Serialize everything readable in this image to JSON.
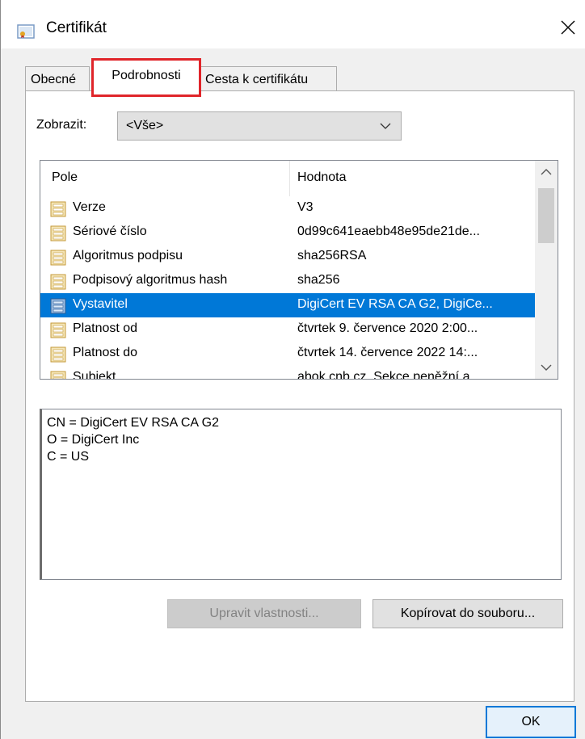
{
  "window": {
    "title": "Certifikát",
    "close_glyph": "✕"
  },
  "tabs": [
    {
      "label": "Obecné"
    },
    {
      "label": "Podrobnosti"
    },
    {
      "label": "Cesta k certifikátu"
    }
  ],
  "filter": {
    "label": "Zobrazit:",
    "selected": "<Vše>"
  },
  "fields_list": {
    "columns": [
      "Pole",
      "Hodnota"
    ],
    "rows": [
      {
        "field": "Verze",
        "value": "V3"
      },
      {
        "field": "Sériové číslo",
        "value": "0d99c641eaebb48e95de21de..."
      },
      {
        "field": "Algoritmus podpisu",
        "value": "sha256RSA"
      },
      {
        "field": "Podpisový algoritmus hash",
        "value": "sha256"
      },
      {
        "field": "Vystavitel",
        "value": "DigiCert EV RSA CA G2, DigiCe...",
        "selected": true
      },
      {
        "field": "Platnost od",
        "value": "čtvrtek 9. července 2020 2:00..."
      },
      {
        "field": "Platnost do",
        "value": "čtvrtek 14. července 2022 14:..."
      },
      {
        "field": "Subjekt",
        "value": "abok.cnb.cz, Sekce peněžní a..."
      }
    ]
  },
  "detail": {
    "lines": [
      "CN = DigiCert EV RSA CA G2",
      "O = DigiCert Inc",
      "C = US"
    ]
  },
  "buttons": {
    "edit_properties": "Upravit vlastnosti...",
    "copy_to_file": "Kopírovat do souboru...",
    "ok": "OK"
  },
  "colors": {
    "selection": "#0078d7",
    "highlight_border": "#e0252a"
  },
  "icons": {
    "window": "certificate-icon",
    "row": "field-icon"
  }
}
